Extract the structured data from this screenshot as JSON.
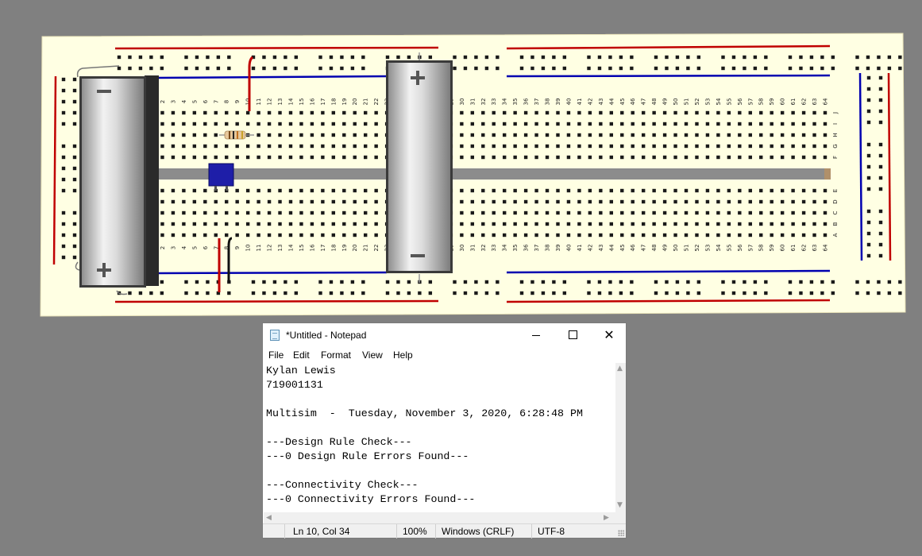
{
  "board": {
    "row_letters_top": [
      "J",
      "I",
      "H",
      "G",
      "F"
    ],
    "row_letters_bottom": [
      "E",
      "D",
      "C",
      "B",
      "A"
    ],
    "column_count": 64,
    "colors": {
      "background": "#808080",
      "board": "#ffffe3",
      "hole": "#1a1a1a",
      "rail_red": "#c00000",
      "rail_blue": "#0000b0",
      "wire_red": "#c00000",
      "wire_black": "#111111",
      "chip": "#1e1ea8",
      "battery_body": "#c8c8c8"
    },
    "battery_left": {
      "top_terminal": "−",
      "bottom_terminal": "+"
    },
    "battery_right": {
      "top_terminal": "+",
      "bottom_terminal": "−"
    }
  },
  "notepad": {
    "title": "*Untitled - Notepad",
    "controls": {
      "minimize": "—",
      "maximize": "□",
      "close": "✕"
    },
    "menu": [
      "File",
      "Edit",
      "Format",
      "View",
      "Help"
    ],
    "content": "Kylan Lewis\n719001131\n\nMultisim  -  Tuesday, November 3, 2020, 6:28:48 PM\n\n---Design Rule Check---\n---0 Design Rule Errors Found---\n\n---Connectivity Check---\n---0 Connectivity Errors Found---",
    "status": {
      "position": "Ln 10, Col 34",
      "zoom": "100%",
      "line_endings": "Windows (CRLF)",
      "encoding": "UTF-8"
    }
  }
}
